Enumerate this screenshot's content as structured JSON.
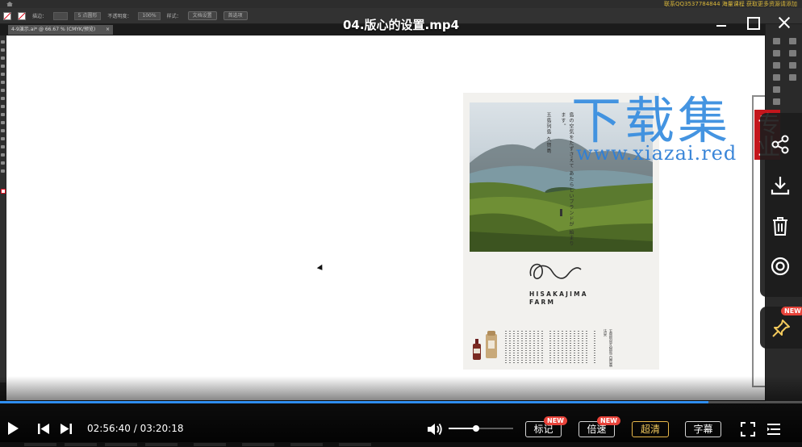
{
  "app": {
    "menubar_promo": "联系QQ3537784844 海量课程 获取更多资源请添加",
    "options": {
      "stroke_label": "描边：",
      "brush": "5 点圆形",
      "opacity_label": "不透明度：",
      "opacity_value": "100%",
      "style_label": "样式：",
      "doc_setup_button": "文档设置",
      "prefs_button": "首选项"
    },
    "document_tab": {
      "label": "4-9演示.ai* @ 66.67 % (CMYK/预览)",
      "close": "×"
    }
  },
  "poster": {
    "vertical_text_1": "五島列島 久賀島",
    "vertical_text_2": "島の空気をたずさえて あたらしいブランドが 始まります。",
    "vertical_text_3": "",
    "brand_line1": "HISAKAJIMA",
    "brand_line2": "FARM",
    "side_vertical_text": "五島列島久賀島 自然農法米"
  },
  "watermark": {
    "cn": "下载集",
    "url": "www.xiazai.red",
    "badge": "专业"
  },
  "player": {
    "title": "04.版心的设置.mp4",
    "progress_fraction": 0.883,
    "time_current": "02:56:40",
    "time_separator": " / ",
    "time_total": "03:20:18",
    "volume_fraction": 0.42,
    "buttons": {
      "mark": "标记",
      "speed": "倍速",
      "hd": "超清",
      "subtitle": "字幕"
    },
    "new_badge": "NEW",
    "colors": {
      "progress": "#2f8ef0",
      "hd_highlight": "#f2c95c",
      "new_badge": "#e8433a"
    }
  }
}
